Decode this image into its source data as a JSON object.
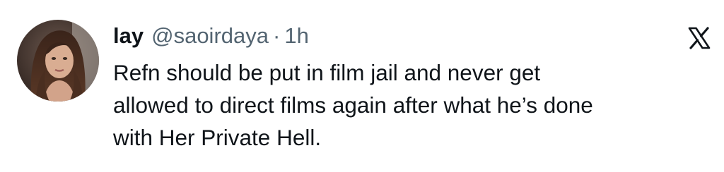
{
  "tweet": {
    "author": {
      "display_name": "lay",
      "handle": "@saoirdaya"
    },
    "separator": "·",
    "timestamp": "1h",
    "text_lines": [
      "Refn should be put in film jail and never get",
      "allowed to direct films again after what he’s done",
      "with Her Private Hell."
    ],
    "icons": {
      "avatar": "user-avatar-photo",
      "brand": "x-logo-icon"
    }
  },
  "colors": {
    "text_primary": "#0f1419",
    "text_secondary": "#536471",
    "background": "#ffffff"
  }
}
